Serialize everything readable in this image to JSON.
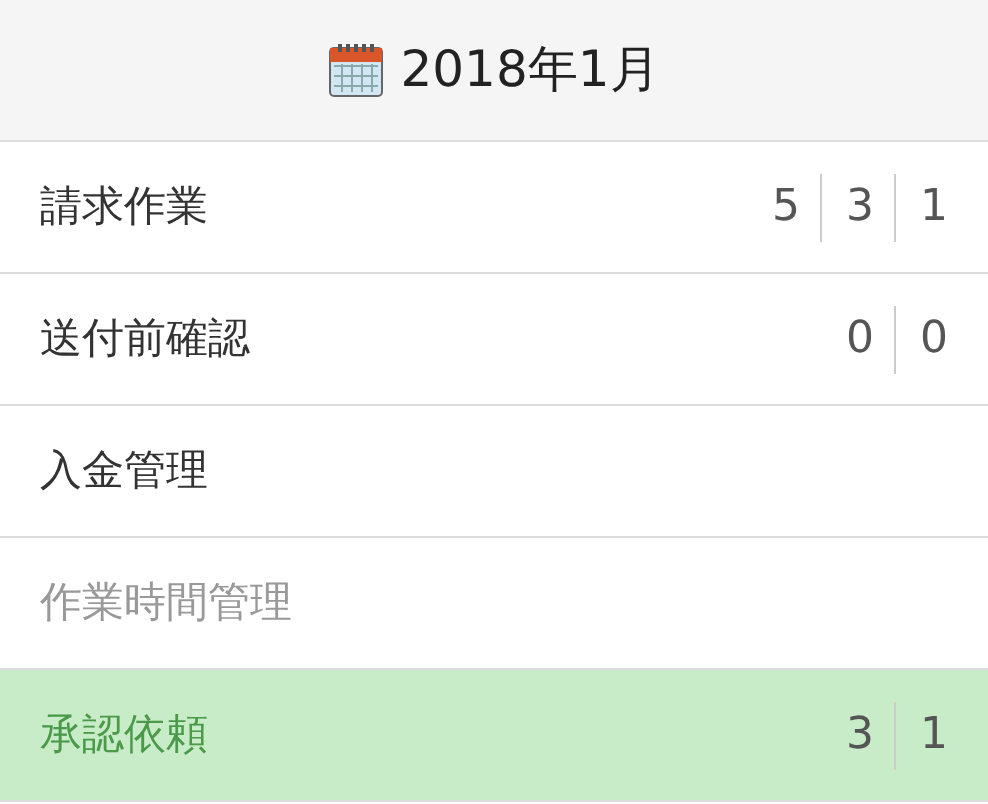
{
  "header": {
    "title": "2018年1月"
  },
  "menu": [
    {
      "label": "請求作業",
      "counts": [
        "5",
        "3",
        "1"
      ],
      "disabled": false,
      "selected": false
    },
    {
      "label": "送付前確認",
      "counts": [
        "0",
        "0"
      ],
      "disabled": false,
      "selected": false
    },
    {
      "label": "入金管理",
      "disabled": false,
      "selected": false
    },
    {
      "label": "作業時間管理",
      "disabled": true,
      "selected": false
    },
    {
      "label": "承認依頼",
      "counts": [
        "3",
        "1"
      ],
      "disabled": false,
      "selected": true
    }
  ]
}
